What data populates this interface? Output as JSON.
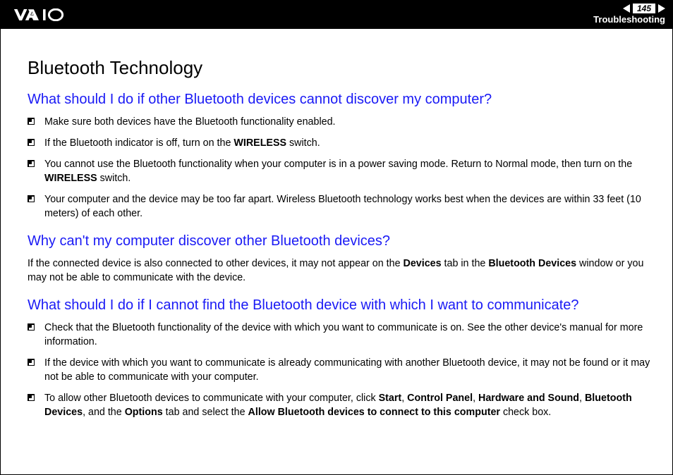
{
  "header": {
    "page_number": "145",
    "section": "Troubleshooting"
  },
  "title": "Bluetooth Technology",
  "q1": {
    "heading": "What should I do if other Bluetooth devices cannot discover my computer?",
    "items": [
      {
        "pre": "Make sure both devices have the Bluetooth functionality enabled."
      },
      {
        "pre": "If the Bluetooth indicator is off, turn on the ",
        "b1": "WIRELESS",
        "post": " switch."
      },
      {
        "pre": "You cannot use the Bluetooth functionality when your computer is in a power saving mode. Return to Normal mode, then turn on the ",
        "b1": "WIRELESS",
        "post": " switch."
      },
      {
        "pre": "Your computer and the device may be too far apart. Wireless Bluetooth technology works best when the devices are within 33 feet (10 meters) of each other."
      }
    ]
  },
  "q2": {
    "heading": "Why can't my computer discover other Bluetooth devices?",
    "para_pre": "If the connected device is also connected to other devices, it may not appear on the ",
    "b1": "Devices",
    "mid": " tab in the ",
    "b2": "Bluetooth Devices",
    "post": " window or you may not be able to communicate with the device."
  },
  "q3": {
    "heading": "What should I do if I cannot find the Bluetooth device with which I want to communicate?",
    "items": [
      {
        "pre": "Check that the Bluetooth functionality of the device with which you want to communicate is on. See the other device's manual for more information."
      },
      {
        "pre": "If the device with which you want to communicate is already communicating with another Bluetooth device, it may not be found or it may not be able to communicate with your computer."
      },
      {
        "pre": "To allow other Bluetooth devices to communicate with your computer, click ",
        "b1": "Start",
        "s1": ", ",
        "b2": "Control Panel",
        "s2": ", ",
        "b3": "Hardware and Sound",
        "s3": ", ",
        "b4": "Bluetooth Devices",
        "s4": ", and the ",
        "b5": "Options",
        "s5": " tab and select the ",
        "b6": "Allow Bluetooth devices to connect to this computer",
        "post": " check box."
      }
    ]
  }
}
